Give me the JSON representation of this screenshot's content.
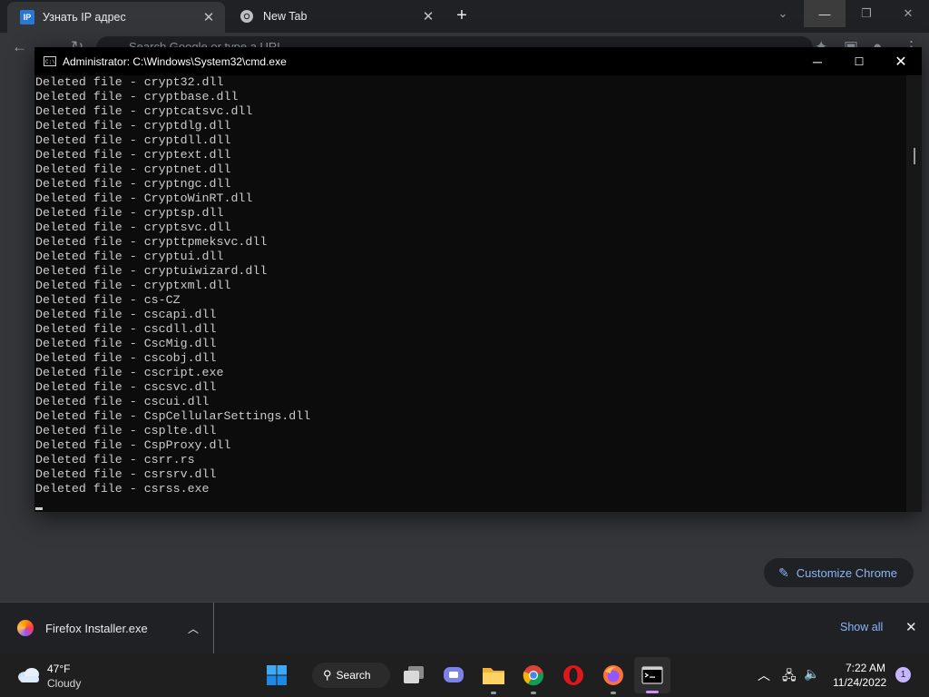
{
  "browser": {
    "tabs": [
      {
        "label": "Узнать IP адрес",
        "favicon": "ip-favicon",
        "favicon_text": "IP"
      },
      {
        "label": "New Tab",
        "favicon": "chrome-icon"
      }
    ],
    "omnibox_placeholder": "Search Google or type a URL",
    "customize_label": "Customize Chrome"
  },
  "cmd": {
    "title": "Administrator: C:\\Windows\\System32\\cmd.exe",
    "icon_text": "C:\\",
    "lines": [
      "Deleted file - crypt32.dll",
      "Deleted file - cryptbase.dll",
      "Deleted file - cryptcatsvc.dll",
      "Deleted file - cryptdlg.dll",
      "Deleted file - cryptdll.dll",
      "Deleted file - cryptext.dll",
      "Deleted file - cryptnet.dll",
      "Deleted file - cryptngc.dll",
      "Deleted file - CryptoWinRT.dll",
      "Deleted file - cryptsp.dll",
      "Deleted file - cryptsvc.dll",
      "Deleted file - crypttpmeksvc.dll",
      "Deleted file - cryptui.dll",
      "Deleted file - cryptuiwizard.dll",
      "Deleted file - cryptxml.dll",
      "Deleted file - cs-CZ",
      "Deleted file - cscapi.dll",
      "Deleted file - cscdll.dll",
      "Deleted file - CscMig.dll",
      "Deleted file - cscobj.dll",
      "Deleted file - cscript.exe",
      "Deleted file - cscsvc.dll",
      "Deleted file - cscui.dll",
      "Deleted file - CspCellularSettings.dll",
      "Deleted file - csplte.dll",
      "Deleted file - CspProxy.dll",
      "Deleted file - csrr.rs",
      "Deleted file - csrsrv.dll",
      "Deleted file - csrss.exe"
    ]
  },
  "download": {
    "filename": "Firefox Installer.exe",
    "show_all": "Show all"
  },
  "taskbar": {
    "weather_temp": "47°F",
    "weather_cond": "Cloudy",
    "search_label": "Search",
    "time": "7:22 AM",
    "date": "11/24/2022",
    "notification_count": "1"
  },
  "colors": {
    "accent_link": "#8ab4f8",
    "console_bg": "#0c0c0c",
    "console_text": "#cccccc"
  }
}
